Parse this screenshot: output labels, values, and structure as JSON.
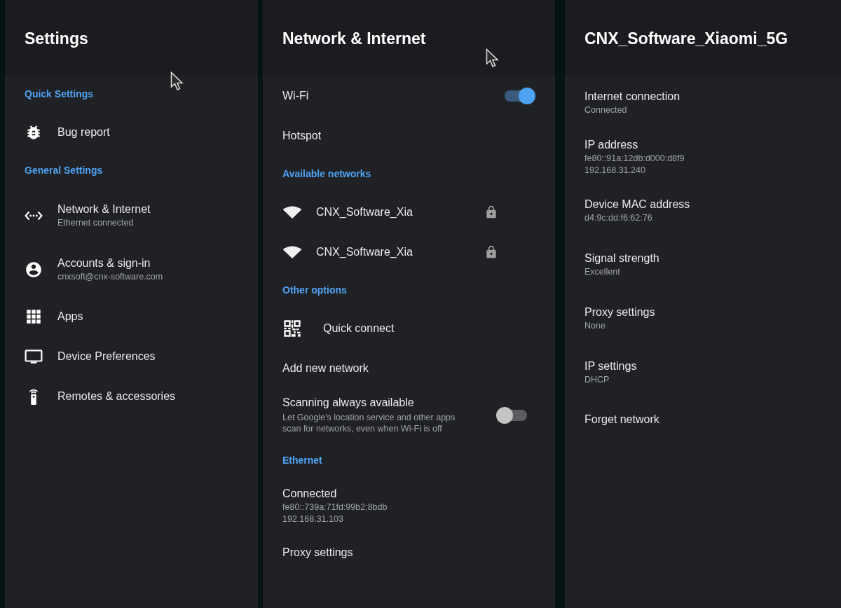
{
  "panels": [
    {
      "title": "Settings",
      "items": [
        {
          "kind": "section",
          "title": "Quick Settings"
        },
        {
          "kind": "icon_row",
          "title": "Bug report"
        },
        {
          "kind": "section",
          "title": "General Settings"
        },
        {
          "kind": "icon_row",
          "title": "Network & Internet",
          "lines": [
            "Ethernet connected"
          ]
        },
        {
          "kind": "icon_row",
          "title": "Accounts & sign-in",
          "lines": [
            "cnxsoft@cnx-software.com"
          ]
        },
        {
          "kind": "icon_row",
          "title": "Apps"
        },
        {
          "kind": "icon_row",
          "title": "Device Preferences"
        },
        {
          "kind": "icon_row",
          "title": "Remotes & accessories"
        }
      ]
    },
    {
      "title": "Network & Internet",
      "items": [
        {
          "kind": "toggle",
          "title": "Wi-Fi",
          "on": true
        },
        {
          "kind": "row",
          "title": "Hotspot"
        },
        {
          "kind": "section",
          "title": "Available networks"
        },
        {
          "kind": "network",
          "title": "CNX_Software_Xia",
          "secured": true
        },
        {
          "kind": "network",
          "title": "CNX_Software_Xia",
          "secured": true
        },
        {
          "kind": "section",
          "title": "Other options"
        },
        {
          "kind": "icon_row",
          "title": "Quick connect"
        },
        {
          "kind": "row",
          "title": "Add new network"
        },
        {
          "kind": "toggle",
          "title": "Scanning always available",
          "on": false,
          "lines": [
            "Let Google's location service and other apps scan for networks, even when Wi-Fi is off"
          ]
        },
        {
          "kind": "section",
          "title": "Ethernet"
        },
        {
          "kind": "row",
          "title": "Connected",
          "lines": [
            "fe80::739a:71fd:99b2:8bdb",
            "192.168.31.103"
          ]
        },
        {
          "kind": "row",
          "title": "Proxy settings"
        }
      ]
    },
    {
      "title": "CNX_Software_Xiaomi_5G",
      "items": [
        {
          "kind": "row",
          "title": "Internet connection",
          "lines": [
            "Connected"
          ]
        },
        {
          "kind": "row",
          "title": "IP address",
          "lines": [
            "fe80::91a:12db:d000:d8f9",
            "192.168.31.240"
          ]
        },
        {
          "kind": "row",
          "title": "Device MAC address",
          "lines": [
            "d4:9c:dd:f6:62:76"
          ]
        },
        {
          "kind": "row",
          "title": "Signal strength",
          "lines": [
            "Excellent"
          ]
        },
        {
          "kind": "row",
          "title": "Proxy settings",
          "lines": [
            "None"
          ]
        },
        {
          "kind": "row",
          "title": "IP settings",
          "lines": [
            "DHCP"
          ]
        },
        {
          "kind": "row",
          "title": "Forget network"
        }
      ]
    }
  ]
}
